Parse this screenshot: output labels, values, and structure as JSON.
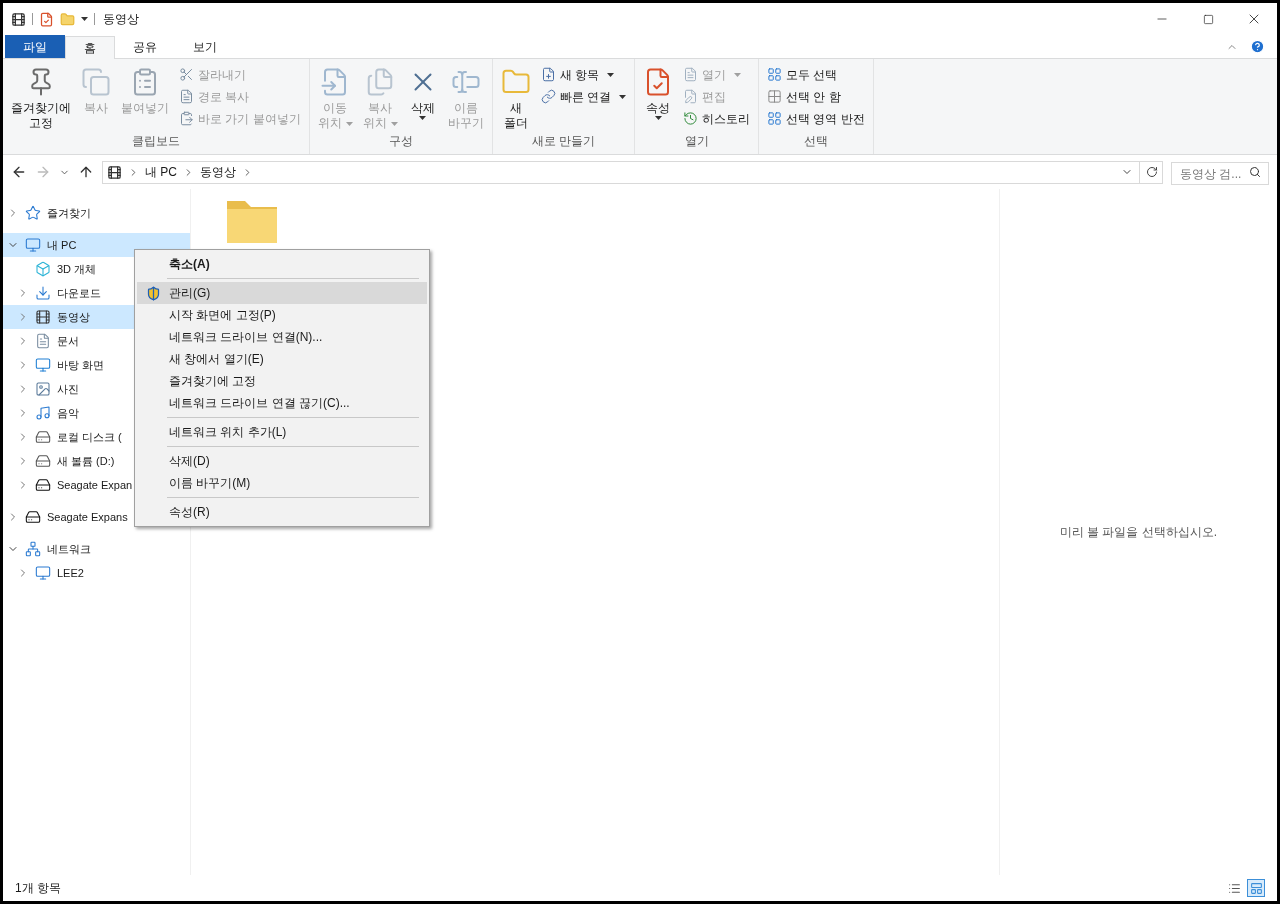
{
  "title_bar": {
    "title": "동영상"
  },
  "ribbon_tabs": [
    {
      "label": "파일",
      "kind": "file",
      "selected": false
    },
    {
      "label": "홈",
      "kind": "tab",
      "selected": true
    },
    {
      "label": "공유",
      "kind": "tab",
      "selected": false
    },
    {
      "label": "보기",
      "kind": "tab",
      "selected": false
    }
  ],
  "ribbon_groups": [
    {
      "label": "클립보드",
      "large": [
        {
          "label": "즐겨찾기에\n고정",
          "disabled": false,
          "dropdown": false
        },
        {
          "label": "복사",
          "disabled": true,
          "dropdown": false
        },
        {
          "label": "붙여넣기",
          "disabled": true,
          "dropdown": false
        }
      ],
      "small": [
        {
          "label": "잘라내기",
          "disabled": true,
          "dropdown": false
        },
        {
          "label": "경로 복사",
          "disabled": true,
          "dropdown": false
        },
        {
          "label": "바로 가기 붙여넣기",
          "disabled": true,
          "dropdown": false
        }
      ]
    },
    {
      "label": "구성",
      "large": [
        {
          "label": "이동\n위치",
          "disabled": true,
          "dropdown": true
        },
        {
          "label": "복사\n위치",
          "disabled": true,
          "dropdown": true
        },
        {
          "label": "삭제",
          "disabled": false,
          "dropdown": true
        },
        {
          "label": "이름\n바꾸기",
          "disabled": true,
          "dropdown": false
        }
      ]
    },
    {
      "label": "새로 만들기",
      "large": [
        {
          "label": "새\n폴더",
          "disabled": false,
          "dropdown": false
        }
      ],
      "small": [
        {
          "label": "새 항목",
          "disabled": false,
          "dropdown": true
        },
        {
          "label": "빠른 연결",
          "disabled": false,
          "dropdown": true
        }
      ]
    },
    {
      "label": "열기",
      "large": [
        {
          "label": "속성",
          "disabled": false,
          "dropdown": true
        }
      ],
      "small": [
        {
          "label": "열기",
          "disabled": true,
          "dropdown": true
        },
        {
          "label": "편집",
          "disabled": true,
          "dropdown": false
        },
        {
          "label": "히스토리",
          "disabled": false,
          "dropdown": false
        }
      ]
    },
    {
      "label": "선택",
      "small": [
        {
          "label": "모두 선택",
          "disabled": false,
          "dropdown": false
        },
        {
          "label": "선택 안 함",
          "disabled": false,
          "dropdown": false
        },
        {
          "label": "선택 영역 반전",
          "disabled": false,
          "dropdown": false
        }
      ]
    }
  ],
  "address_bar": {
    "breadcrumbs": [
      "내 PC",
      "동영상"
    ],
    "search": {
      "placeholder": "동영상 검..."
    }
  },
  "nav_tree": [
    {
      "label": "즐겨찾기",
      "expanded": false,
      "selected": false
    },
    {
      "label": "내 PC",
      "expanded": true,
      "selected": true,
      "children": [
        {
          "label": "3D 개체",
          "selected": false
        },
        {
          "label": "다운로드",
          "expanded": false,
          "selected": false
        },
        {
          "label": "동영상",
          "expanded": false,
          "selected": true
        },
        {
          "label": "문서",
          "expanded": false,
          "selected": false
        },
        {
          "label": "바탕 화면",
          "expanded": false,
          "selected": false
        },
        {
          "label": "사진",
          "expanded": false,
          "selected": false
        },
        {
          "label": "음악",
          "expanded": false,
          "selected": false
        },
        {
          "label": "로컬 디스크 (",
          "expanded": false,
          "selected": false
        },
        {
          "label": "새 볼륨 (D:)",
          "expanded": false,
          "selected": false
        },
        {
          "label": "Seagate Expan",
          "expanded": false,
          "selected": false
        }
      ]
    },
    {
      "label": "Seagate Expans",
      "expanded": false,
      "selected": false
    },
    {
      "label": "네트워크",
      "expanded": true,
      "selected": false,
      "children": [
        {
          "label": "LEE2",
          "expanded": false,
          "selected": false
        }
      ]
    }
  ],
  "context_menu": [
    {
      "kind": "default",
      "label": "축소(A)",
      "selected": false
    },
    {
      "kind": "separator"
    },
    {
      "kind": "elevated",
      "label": "관리(G)",
      "selected": true
    },
    {
      "kind": "command",
      "label": "시작 화면에 고정(P)",
      "selected": false
    },
    {
      "kind": "command",
      "label": "네트워크 드라이브 연결(N)...",
      "selected": false
    },
    {
      "kind": "command",
      "label": "새 창에서 열기(E)",
      "selected": false
    },
    {
      "kind": "command",
      "label": "즐겨찾기에 고정",
      "selected": false
    },
    {
      "kind": "command",
      "label": "네트워크 드라이브 연결 끊기(C)...",
      "selected": false
    },
    {
      "kind": "separator"
    },
    {
      "kind": "command",
      "label": "네트워크 위치 추가(L)",
      "selected": false
    },
    {
      "kind": "separator"
    },
    {
      "kind": "command",
      "label": "삭제(D)",
      "selected": false
    },
    {
      "kind": "command",
      "label": "이름 바꾸기(M)",
      "selected": false
    },
    {
      "kind": "separator"
    },
    {
      "kind": "command",
      "label": "속성(R)",
      "selected": false
    }
  ],
  "preview_pane": {
    "message": "미리 볼 파일을 선택하십시오."
  },
  "status_bar": {
    "item_count": "1개 항목",
    "view_buttons": [
      {
        "selected": false
      },
      {
        "selected": true
      }
    ]
  }
}
